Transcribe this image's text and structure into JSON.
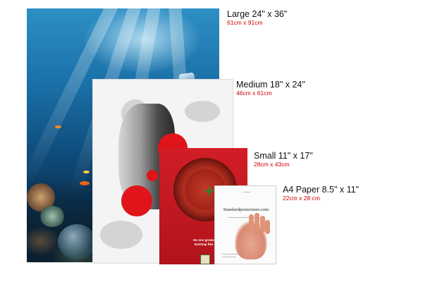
{
  "sizes": {
    "large": {
      "label": "Large 24\" x 36\"",
      "metric": "61cm x 91cm"
    },
    "medium": {
      "label": "Medium 18\" x 24\"",
      "metric": "46cm x 61cm"
    },
    "small": {
      "label": "Small 11\" x 17\"",
      "metric": "28cm x 43cm"
    },
    "a4": {
      "label": "A4 Paper 8.5\" x 11\"",
      "metric": "22cm x 28 cm"
    }
  },
  "posters": {
    "small_tagline": "No one grows Ketchup like",
    "a4_site": "Standardpostersizes.com"
  },
  "colors": {
    "label_text": "#111111",
    "metric_text": "#cc0000"
  }
}
